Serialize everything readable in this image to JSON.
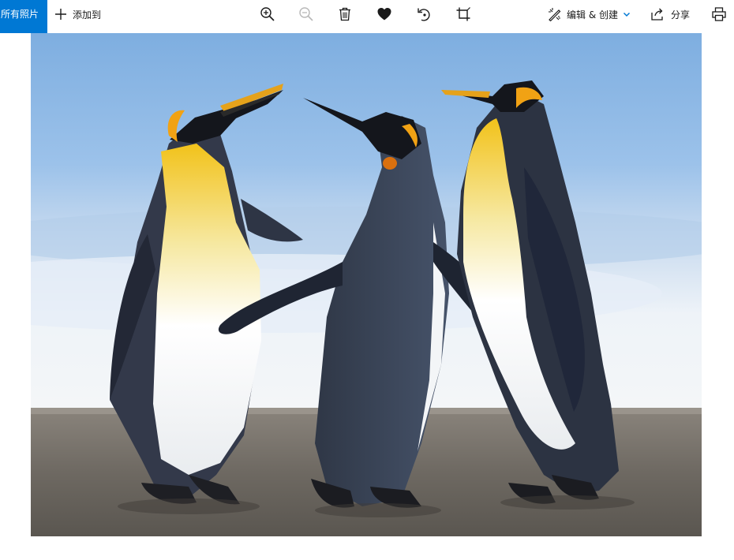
{
  "toolbar": {
    "all_photos_label": "所有照片",
    "add_to_label": "添加到",
    "edit_create_label": "编辑 & 创建",
    "share_label": "分享",
    "accent_color": "#0078d4",
    "icons": {
      "zoom_in": "zoom-in-icon",
      "zoom_out": "zoom-out-icon",
      "delete": "trash-icon",
      "favorite": "heart-icon",
      "rotate": "rotate-icon",
      "crop": "crop-icon",
      "edit": "edit-create-icon",
      "share": "share-icon",
      "print": "print-icon"
    },
    "zoom_out_disabled": true
  },
  "photo": {
    "subject": "three emperor penguins on a beach"
  }
}
